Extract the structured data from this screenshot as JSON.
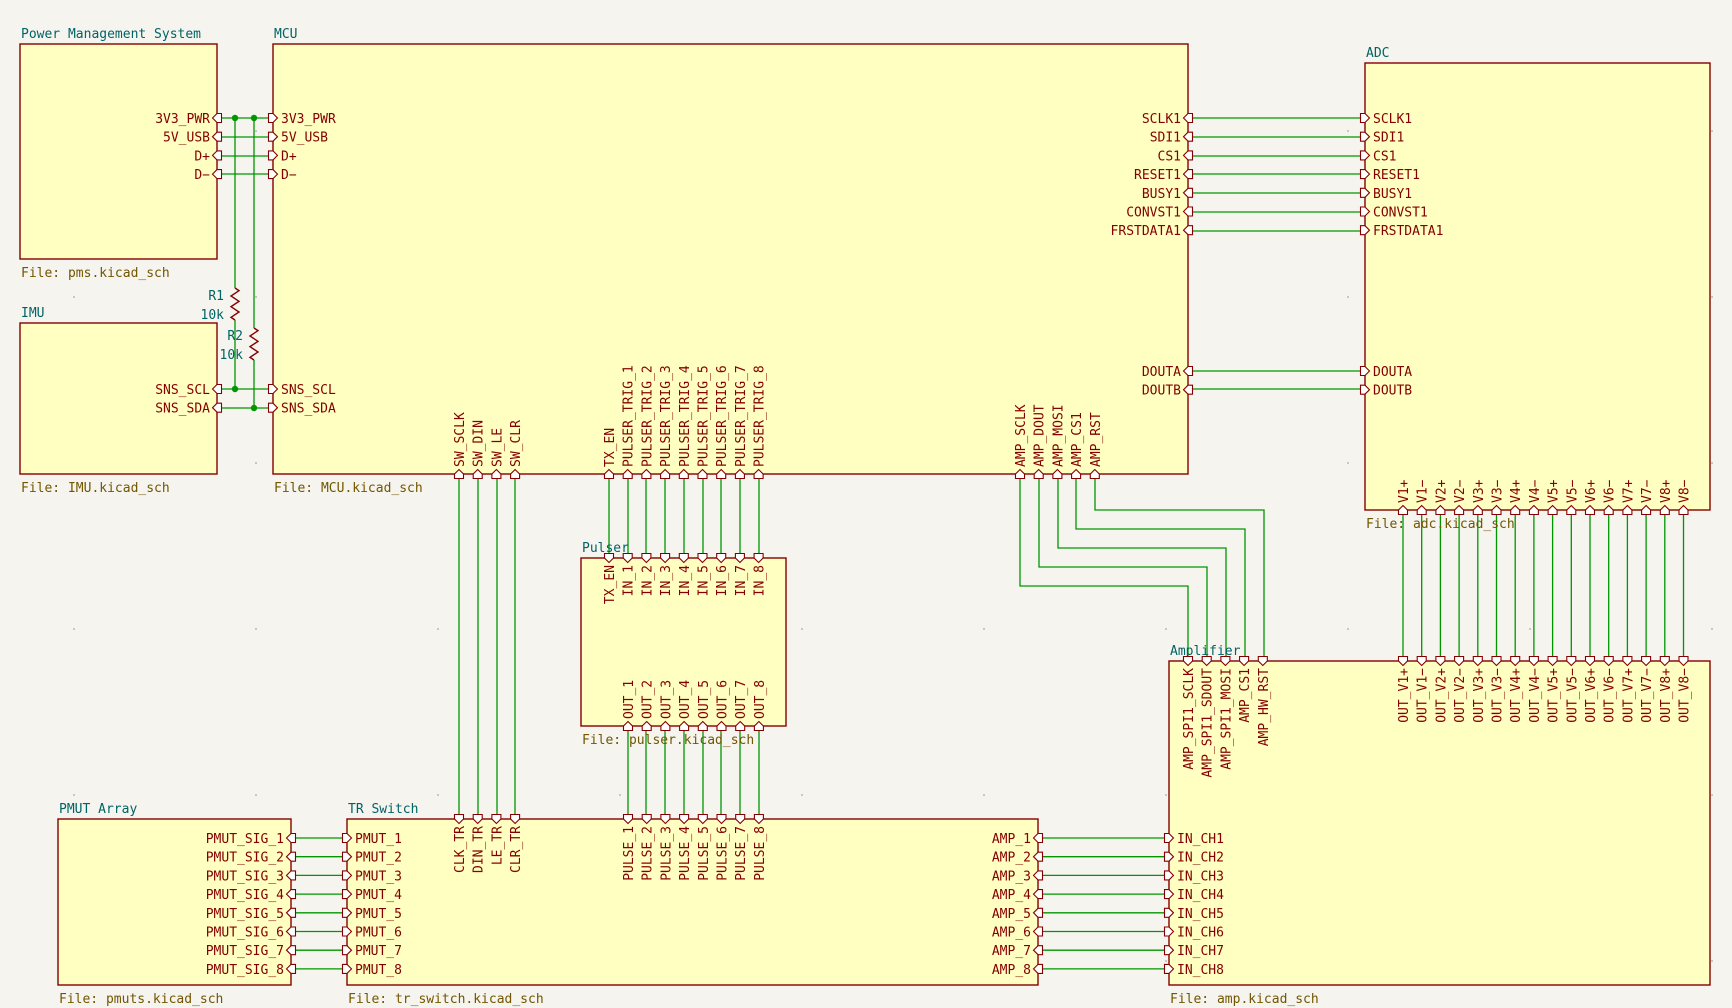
{
  "sheets": {
    "pms": {
      "title": "Power Management System",
      "file": "File: pms.kicad_sch"
    },
    "mcu": {
      "title": "MCU",
      "file": "File: MCU.kicad_sch"
    },
    "adc": {
      "title": "ADC",
      "file": "File: adc.kicad_sch"
    },
    "imu": {
      "title": "IMU",
      "file": "File: IMU.kicad_sch"
    },
    "pulser": {
      "title": "Pulser",
      "file": "File: pulser.kicad_sch"
    },
    "pmut": {
      "title": "PMUT Array",
      "file": "File: pmuts.kicad_sch"
    },
    "tr": {
      "title": "TR Switch",
      "file": "File: tr_switch.kicad_sch"
    },
    "amp": {
      "title": "Amplifier",
      "file": "File: amp.kicad_sch"
    }
  },
  "pins": {
    "pms_right": [
      "3V3_PWR",
      "5V_USB",
      "D+",
      "D−"
    ],
    "mcu_left": [
      "3V3_PWR",
      "5V_USB",
      "D+",
      "D−"
    ],
    "imu_right": [
      "SNS_SCL",
      "SNS_SDA"
    ],
    "mcu_left_sns": [
      "SNS_SCL",
      "SNS_SDA"
    ],
    "mcu_right": [
      "SCLK1",
      "SDI1",
      "CS1",
      "RESET1",
      "BUSY1",
      "CONVST1",
      "FRSTDATA1"
    ],
    "adc_left": [
      "SCLK1",
      "SDI1",
      "CS1",
      "RESET1",
      "BUSY1",
      "CONVST1",
      "FRSTDATA1"
    ],
    "mcu_right_dout": [
      "DOUTA",
      "DOUTB"
    ],
    "adc_left_dout": [
      "DOUTA",
      "DOUTB"
    ],
    "mcu_bottom_sw": [
      "SW_SCLK",
      "SW_DIN",
      "SW_LE",
      "SW_CLR"
    ],
    "mcu_bottom_pulser": [
      "TX_EN",
      "PULSER_TRIG_1",
      "PULSER_TRIG_2",
      "PULSER_TRIG_3",
      "PULSER_TRIG_4",
      "PULSER_TRIG_5",
      "PULSER_TRIG_6",
      "PULSER_TRIG_7",
      "PULSER_TRIG_8"
    ],
    "mcu_bottom_amp": [
      "AMP_SCLK",
      "AMP_DOUT",
      "AMP_MOSI",
      "AMP_CS1",
      "AMP_RST"
    ],
    "pulser_top": [
      "TX_EN",
      "IN_1",
      "IN_2",
      "IN_3",
      "IN_4",
      "IN_5",
      "IN_6",
      "IN_7",
      "IN_8"
    ],
    "pulser_bottom": [
      "OUT_1",
      "OUT_2",
      "OUT_3",
      "OUT_4",
      "OUT_5",
      "OUT_6",
      "OUT_7",
      "OUT_8"
    ],
    "adc_bottom": [
      "V1+",
      "V1−",
      "V2+",
      "V2−",
      "V3+",
      "V3−",
      "V4+",
      "V4−",
      "V5+",
      "V5−",
      "V6+",
      "V6−",
      "V7+",
      "V7−",
      "V8+",
      "V8−"
    ],
    "amp_top_left": [
      "AMP_SPI1_SCLK",
      "AMP_SPI1_SDOUT",
      "AMP_SPI1_MOSI",
      "AMP_CS1",
      "AMP_HW_RST"
    ],
    "amp_top_right": [
      "OUT_V1+",
      "OUT_V1−",
      "OUT_V2+",
      "OUT_V2−",
      "OUT_V3+",
      "OUT_V3−",
      "OUT_V4+",
      "OUT_V4−",
      "OUT_V5+",
      "OUT_V5−",
      "OUT_V6+",
      "OUT_V6−",
      "OUT_V7+",
      "OUT_V7−",
      "OUT_V8+",
      "OUT_V8−"
    ],
    "pmut_right": [
      "PMUT_SIG_1",
      "PMUT_SIG_2",
      "PMUT_SIG_3",
      "PMUT_SIG_4",
      "PMUT_SIG_5",
      "PMUT_SIG_6",
      "PMUT_SIG_7",
      "PMUT_SIG_8"
    ],
    "tr_left": [
      "PMUT_1",
      "PMUT_2",
      "PMUT_3",
      "PMUT_4",
      "PMUT_5",
      "PMUT_6",
      "PMUT_7",
      "PMUT_8"
    ],
    "tr_top_ctrl": [
      "CLK_TR",
      "DIN_TR",
      "LE_TR",
      "CLR_TR"
    ],
    "tr_top_pulse": [
      "PULSE_1",
      "PULSE_2",
      "PULSE_3",
      "PULSE_4",
      "PULSE_5",
      "PULSE_6",
      "PULSE_7",
      "PULSE_8"
    ],
    "tr_right": [
      "AMP_1",
      "AMP_2",
      "AMP_3",
      "AMP_4",
      "AMP_5",
      "AMP_6",
      "AMP_7",
      "AMP_8"
    ],
    "amp_left": [
      "IN_CH1",
      "IN_CH2",
      "IN_CH3",
      "IN_CH4",
      "IN_CH5",
      "IN_CH6",
      "IN_CH7",
      "IN_CH8"
    ]
  },
  "resistors": [
    {
      "ref": "R1",
      "value": "10k"
    },
    {
      "ref": "R2",
      "value": "10k"
    }
  ],
  "colors": {
    "sheet_fill": "#ffffc2",
    "sheet_border": "#840000",
    "wire": "#009600",
    "title": "#006464",
    "file": "#725600"
  }
}
